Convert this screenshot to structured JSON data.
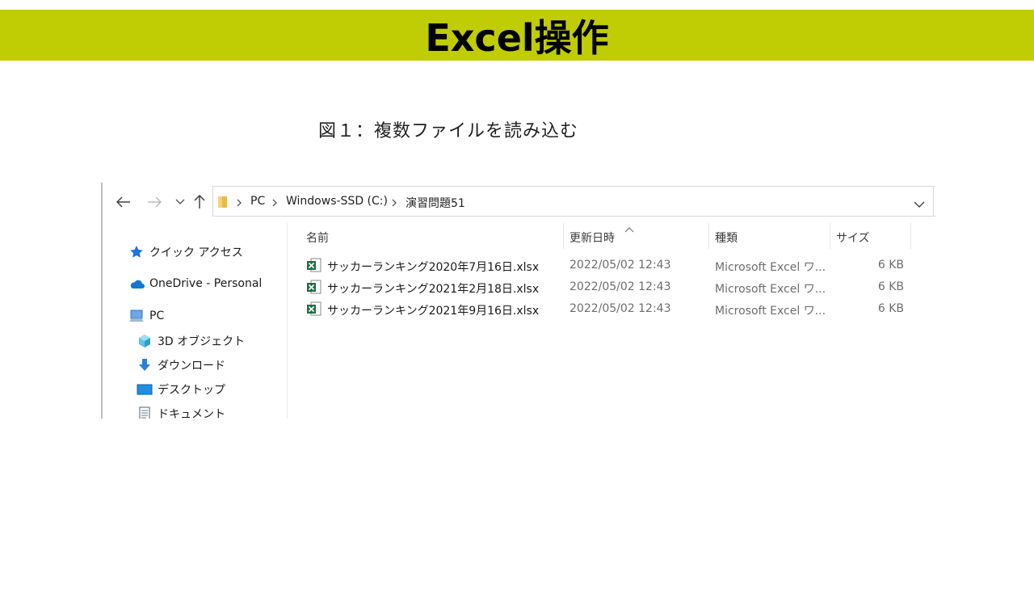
{
  "slide": {
    "title": "Excel操作",
    "caption": "図１：複数ファイルを読み込む"
  },
  "explorer": {
    "breadcrumb": [
      "PC",
      "Windows-SSD (C:)",
      "演習問題51"
    ],
    "nav": {
      "quick_access": "クイック アクセス",
      "onedrive": "OneDrive - Personal",
      "pc": "PC",
      "objects3d": "3D オブジェクト",
      "downloads": "ダウンロード",
      "desktop": "デスクトップ",
      "documents": "ドキュメント"
    },
    "columns": {
      "name": "名前",
      "date": "更新日時",
      "type": "種類",
      "size": "サイズ"
    },
    "files": [
      {
        "name": "サッカーランキング2020年7月16日.xlsx",
        "date": "2022/05/02 12:43",
        "type": "Microsoft Excel ワ...",
        "size": "6 KB"
      },
      {
        "name": "サッカーランキング2021年2月18日.xlsx",
        "date": "2022/05/02 12:43",
        "type": "Microsoft Excel ワ...",
        "size": "6 KB"
      },
      {
        "name": "サッカーランキング2021年9月16日.xlsx",
        "date": "2022/05/02 12:43",
        "type": "Microsoft Excel ワ...",
        "size": "6 KB"
      }
    ],
    "icons": {
      "back": "back-arrow-icon",
      "forward": "forward-arrow-icon",
      "recent": "chevron-down-icon",
      "up": "up-arrow-icon",
      "folder": "folder-icon",
      "excel": "excel-file-icon"
    },
    "colors": {
      "title_bar": "#c0cc04",
      "excel_green": "#1e7145",
      "onedrive_blue": "#0f78d4",
      "quick_access_blue": "#1a73e8"
    }
  }
}
